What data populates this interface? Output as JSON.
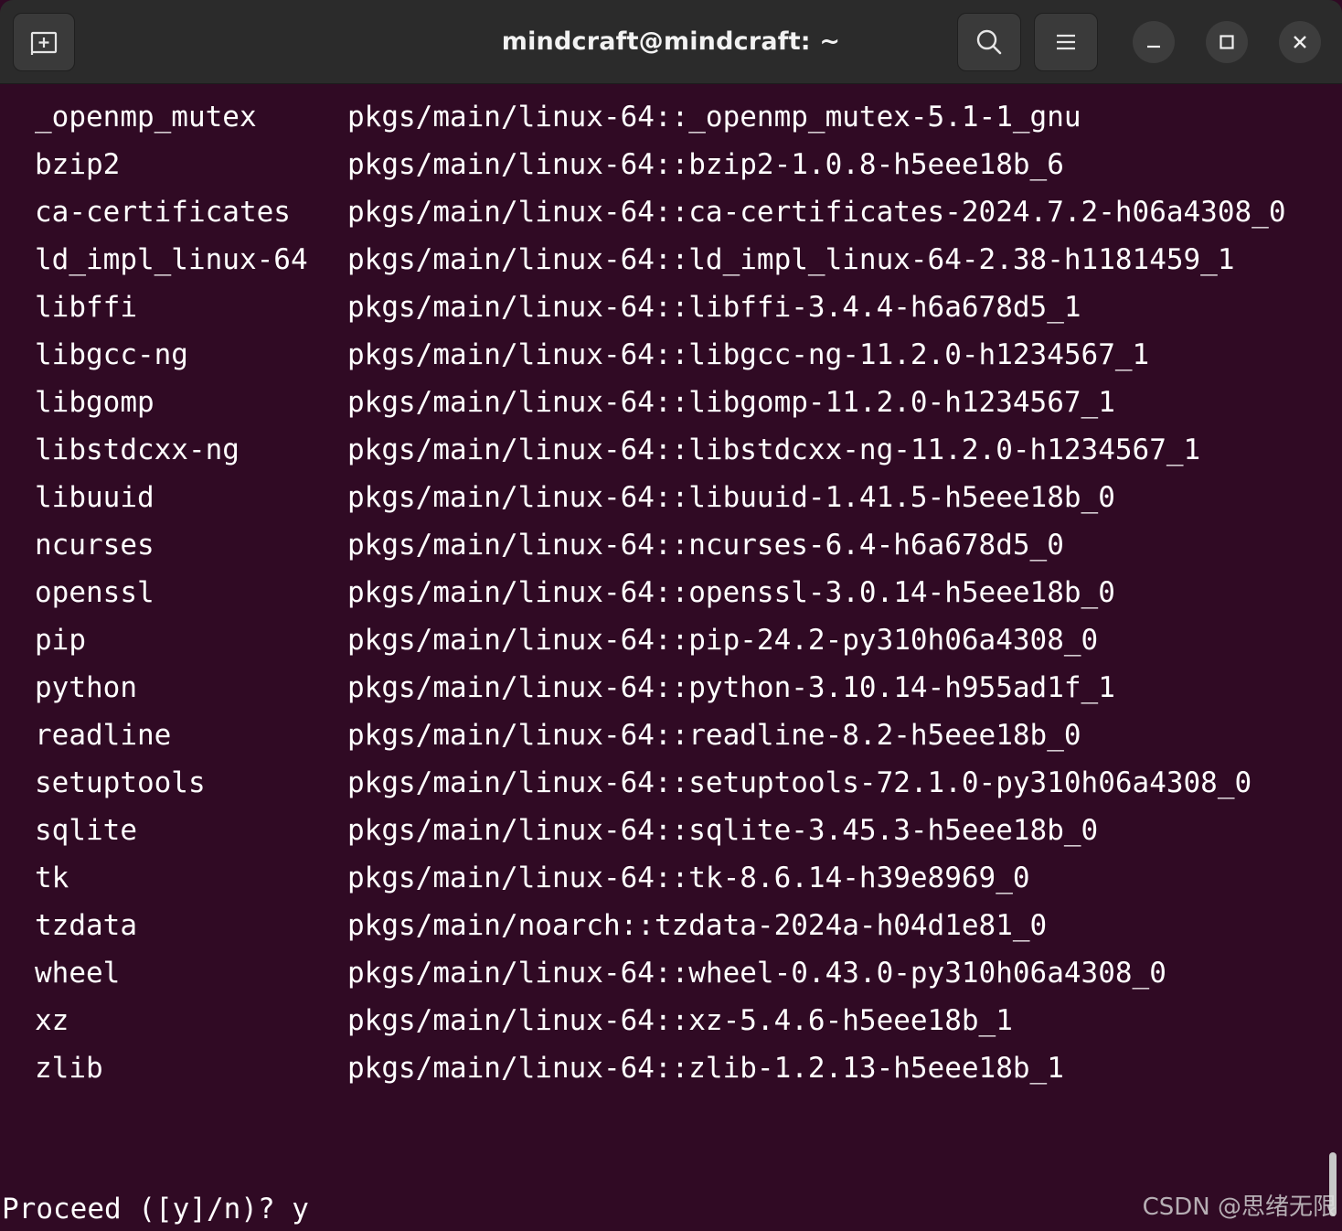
{
  "window": {
    "title": "mindcraft@mindcraft: ~"
  },
  "titlebar": {
    "new_tab_icon": "new-tab-icon",
    "search_icon": "search-icon",
    "menu_icon": "hamburger-menu-icon",
    "minimize_icon": "minimize-icon",
    "maximize_icon": "maximize-icon",
    "close_icon": "close-icon"
  },
  "packages": [
    {
      "name": "_openmp_mutex",
      "source": "pkgs/main/linux-64::_openmp_mutex-5.1-1_gnu"
    },
    {
      "name": "bzip2",
      "source": "pkgs/main/linux-64::bzip2-1.0.8-h5eee18b_6"
    },
    {
      "name": "ca-certificates",
      "source": "pkgs/main/linux-64::ca-certificates-2024.7.2-h06a4308_0"
    },
    {
      "name": "ld_impl_linux-64",
      "source": "pkgs/main/linux-64::ld_impl_linux-64-2.38-h1181459_1"
    },
    {
      "name": "libffi",
      "source": "pkgs/main/linux-64::libffi-3.4.4-h6a678d5_1"
    },
    {
      "name": "libgcc-ng",
      "source": "pkgs/main/linux-64::libgcc-ng-11.2.0-h1234567_1"
    },
    {
      "name": "libgomp",
      "source": "pkgs/main/linux-64::libgomp-11.2.0-h1234567_1"
    },
    {
      "name": "libstdcxx-ng",
      "source": "pkgs/main/linux-64::libstdcxx-ng-11.2.0-h1234567_1"
    },
    {
      "name": "libuuid",
      "source": "pkgs/main/linux-64::libuuid-1.41.5-h5eee18b_0"
    },
    {
      "name": "ncurses",
      "source": "pkgs/main/linux-64::ncurses-6.4-h6a678d5_0"
    },
    {
      "name": "openssl",
      "source": "pkgs/main/linux-64::openssl-3.0.14-h5eee18b_0"
    },
    {
      "name": "pip",
      "source": "pkgs/main/linux-64::pip-24.2-py310h06a4308_0"
    },
    {
      "name": "python",
      "source": "pkgs/main/linux-64::python-3.10.14-h955ad1f_1"
    },
    {
      "name": "readline",
      "source": "pkgs/main/linux-64::readline-8.2-h5eee18b_0"
    },
    {
      "name": "setuptools",
      "source": "pkgs/main/linux-64::setuptools-72.1.0-py310h06a4308_0"
    },
    {
      "name": "sqlite",
      "source": "pkgs/main/linux-64::sqlite-3.45.3-h5eee18b_0"
    },
    {
      "name": "tk",
      "source": "pkgs/main/linux-64::tk-8.6.14-h39e8969_0"
    },
    {
      "name": "tzdata",
      "source": "pkgs/main/noarch::tzdata-2024a-h04d1e81_0"
    },
    {
      "name": "wheel",
      "source": "pkgs/main/linux-64::wheel-0.43.0-py310h06a4308_0"
    },
    {
      "name": "xz",
      "source": "pkgs/main/linux-64::xz-5.4.6-h5eee18b_1"
    },
    {
      "name": "zlib",
      "source": "pkgs/main/linux-64::zlib-1.2.13-h5eee18b_1"
    }
  ],
  "prompt": {
    "text": "Proceed ([y]/n)? y"
  },
  "watermark": {
    "text": "CSDN @思绪无限"
  },
  "colors": {
    "terminal_bg": "#300a24",
    "titlebar_bg": "#2b2b2b",
    "text": "#ffffff"
  }
}
